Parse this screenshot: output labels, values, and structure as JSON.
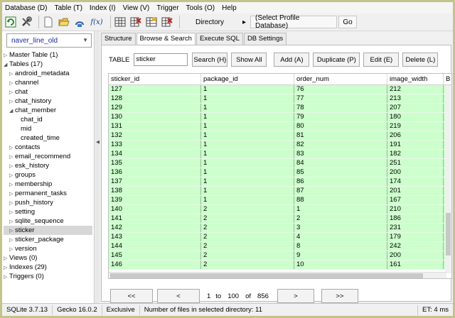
{
  "menu": [
    {
      "label": "Database (D)"
    },
    {
      "label": "Table (T)"
    },
    {
      "label": "Index (I)"
    },
    {
      "label": "View (V)"
    },
    {
      "label": "Trigger"
    },
    {
      "label": "Tools (O)"
    },
    {
      "label": "Help"
    }
  ],
  "toolbar": {
    "directory_label": "Directory",
    "arrow": "▸",
    "profile_select": "(Select Profile Database)",
    "go_label": "Go",
    "fx_label": "f(x)"
  },
  "left": {
    "db_name": "naver_line_old",
    "tree": [
      {
        "label": "Master Table (1)",
        "twisty": "▷",
        "indent": 0
      },
      {
        "label": "Tables (17)",
        "twisty": "◢",
        "indent": 0
      },
      {
        "label": "android_metadata",
        "twisty": "▷",
        "indent": 1
      },
      {
        "label": "channel",
        "twisty": "▷",
        "indent": 1
      },
      {
        "label": "chat",
        "twisty": "▷",
        "indent": 1
      },
      {
        "label": "chat_history",
        "twisty": "▷",
        "indent": 1
      },
      {
        "label": "chat_member",
        "twisty": "◢",
        "indent": 1
      },
      {
        "label": "chat_id",
        "twisty": "",
        "indent": 2
      },
      {
        "label": "mid",
        "twisty": "",
        "indent": 2
      },
      {
        "label": "created_time",
        "twisty": "",
        "indent": 2
      },
      {
        "label": "contacts",
        "twisty": "▷",
        "indent": 1
      },
      {
        "label": "email_recommend",
        "twisty": "▷",
        "indent": 1
      },
      {
        "label": "esk_history",
        "twisty": "▷",
        "indent": 1
      },
      {
        "label": "groups",
        "twisty": "▷",
        "indent": 1
      },
      {
        "label": "membership",
        "twisty": "▷",
        "indent": 1
      },
      {
        "label": "permanent_tasks",
        "twisty": "▷",
        "indent": 1
      },
      {
        "label": "push_history",
        "twisty": "▷",
        "indent": 1
      },
      {
        "label": "setting",
        "twisty": "▷",
        "indent": 1
      },
      {
        "label": "sqlite_sequence",
        "twisty": "▷",
        "indent": 1
      },
      {
        "label": "sticker",
        "twisty": "▷",
        "indent": 1,
        "selected": true
      },
      {
        "label": "sticker_package",
        "twisty": "▷",
        "indent": 1
      },
      {
        "label": "version",
        "twisty": "▷",
        "indent": 1
      },
      {
        "label": "Views (0)",
        "twisty": "▷",
        "indent": 0
      },
      {
        "label": "Indexes (29)",
        "twisty": "▷",
        "indent": 0
      },
      {
        "label": "Triggers (0)",
        "twisty": "▷",
        "indent": 0
      }
    ]
  },
  "tabs": [
    {
      "label": "Structure",
      "active": false
    },
    {
      "label": "Browse & Search",
      "active": true
    },
    {
      "label": "Execute SQL",
      "active": false
    },
    {
      "label": "DB Settings",
      "active": false
    }
  ],
  "browse": {
    "table_label": "TABLE",
    "table_value": "sticker",
    "search_btn": "Search (H)",
    "showall_btn": "Show All",
    "add_btn": "Add (A)",
    "duplicate_btn": "Duplicate (P)",
    "edit_btn": "Edit (E)",
    "delete_btn": "Delete (L)"
  },
  "grid": {
    "columns": [
      "sticker_id",
      "package_id",
      "order_num",
      "image_width",
      "B"
    ],
    "rows": [
      [
        "127",
        "1",
        "76",
        "212"
      ],
      [
        "128",
        "1",
        "77",
        "213"
      ],
      [
        "129",
        "1",
        "78",
        "207"
      ],
      [
        "130",
        "1",
        "79",
        "180"
      ],
      [
        "131",
        "1",
        "80",
        "219"
      ],
      [
        "132",
        "1",
        "81",
        "206"
      ],
      [
        "133",
        "1",
        "82",
        "191"
      ],
      [
        "134",
        "1",
        "83",
        "182"
      ],
      [
        "135",
        "1",
        "84",
        "251"
      ],
      [
        "136",
        "1",
        "85",
        "200"
      ],
      [
        "137",
        "1",
        "86",
        "174"
      ],
      [
        "138",
        "1",
        "87",
        "201"
      ],
      [
        "139",
        "1",
        "88",
        "167"
      ],
      [
        "140",
        "2",
        "1",
        "210"
      ],
      [
        "141",
        "2",
        "2",
        "186"
      ],
      [
        "142",
        "2",
        "3",
        "231"
      ],
      [
        "143",
        "2",
        "4",
        "179"
      ],
      [
        "144",
        "2",
        "8",
        "242"
      ],
      [
        "145",
        "2",
        "9",
        "200"
      ],
      [
        "146",
        "2",
        "10",
        "161"
      ]
    ]
  },
  "pager": {
    "first": "<<",
    "prev": "<",
    "from": "1",
    "to_word": "to",
    "to": "100",
    "of_word": "of",
    "total": "856",
    "next": ">",
    "last": ">>"
  },
  "status": {
    "sqlite": "SQLite 3.7.13",
    "gecko": "Gecko 16.0.2",
    "mode": "Exclusive",
    "files": "Number of files in selected directory: 11",
    "et": "ET: 4 ms"
  },
  "colors": {
    "row_bg": "#ccffcc",
    "db_name": "#1a2aa8",
    "frame": "#c4c48a"
  }
}
